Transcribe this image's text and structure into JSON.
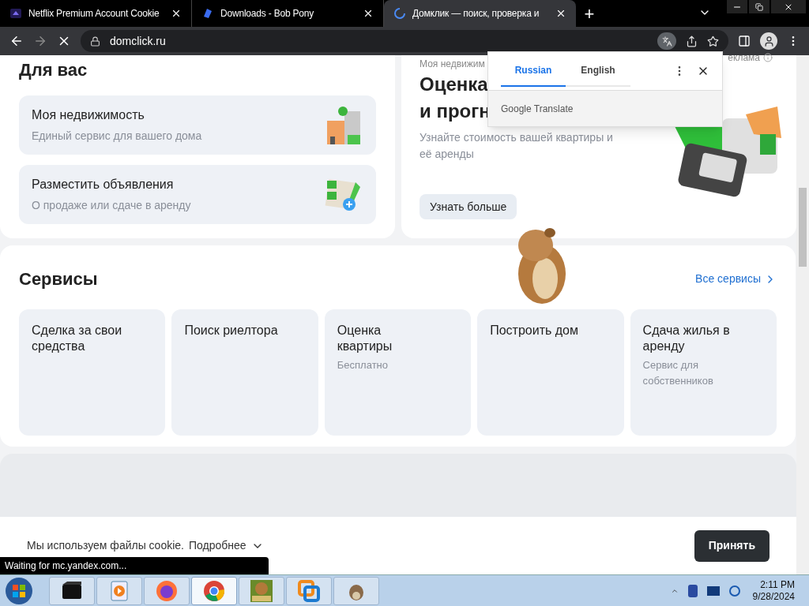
{
  "browser": {
    "tabs": [
      {
        "title": "Netflix Premium Account Cookie",
        "selected": false,
        "kind": "netflix"
      },
      {
        "title": "Downloads - Bob Pony",
        "selected": false,
        "kind": "bobpony"
      },
      {
        "title": "Домклик — поиск, проверка и",
        "selected": true,
        "kind": "loading"
      }
    ],
    "new_tab": "+",
    "url": "domclick.ru"
  },
  "for_you": {
    "title": "Для вас",
    "items": [
      {
        "title": "Моя недвижимость",
        "subtitle": "Единый сервис для вашего дома",
        "kind": "buildings"
      },
      {
        "title": "Разместить объявления",
        "subtitle": "О продаже или сдаче в аренду",
        "kind": "listings"
      }
    ]
  },
  "promo": {
    "eyebrow": "Моя недвижим",
    "title_lines": [
      "Оценка",
      "и прогн"
    ],
    "ad_label": "еклама",
    "text": "Узнайте стоимость вашей квартиры и её аренды",
    "button": "Узнать больше"
  },
  "translate_popup": {
    "tabs": [
      {
        "label": "Russian",
        "selected": true
      },
      {
        "label": "English",
        "selected": false
      }
    ],
    "footer": "Google Translate"
  },
  "services": {
    "title": "Сервисы",
    "all_link": "Все сервисы",
    "items": [
      {
        "title": "Сделка за свои средства"
      },
      {
        "title": "Поиск риелтора"
      },
      {
        "title": "Оценка квартиры",
        "subtitle": "Бесплатно"
      },
      {
        "title": "Построить дом"
      },
      {
        "title": "Сдача жилья в аренду",
        "subtitle": "Сервис для собственников"
      }
    ]
  },
  "cookie_banner": {
    "text": "Мы используем файлы cookie.",
    "more": "Подробнее",
    "accept": "Принять"
  },
  "status_bubble": "Waiting for mc.yandex.com...",
  "taskbar": {
    "apps": [
      {
        "kind": "box",
        "selected": false
      },
      {
        "kind": "media",
        "selected": false
      },
      {
        "kind": "firefox",
        "selected": false
      },
      {
        "kind": "chrome",
        "selected": true
      },
      {
        "kind": "game",
        "selected": false
      },
      {
        "kind": "vm",
        "selected": false
      },
      {
        "kind": "dog",
        "selected": false
      }
    ],
    "time": "2:11 PM",
    "date": "9/28/2024"
  }
}
